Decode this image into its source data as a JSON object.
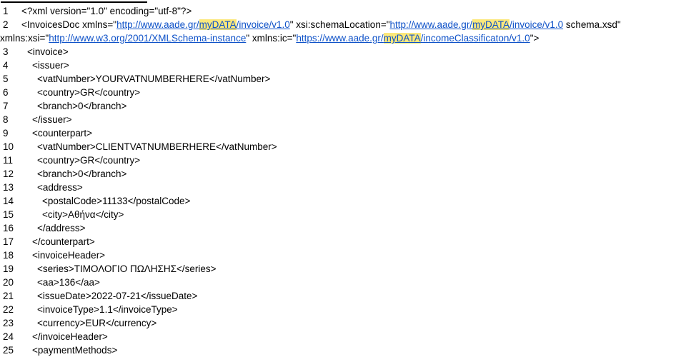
{
  "colors": {
    "text": "#000000",
    "link": "#0f52c8",
    "highlight": "#fbe87b",
    "rule": "#000000",
    "background": "#ffffff"
  },
  "document": {
    "rows": [
      {
        "num": "1",
        "indent": 1,
        "segments": [
          {
            "k": "plain",
            "t": "<?xml version=\"1.0\" encoding=\"utf-8\"?>"
          }
        ]
      },
      {
        "num": "2",
        "indent": 1,
        "segments": [
          {
            "k": "plain",
            "t": "<InvoicesDoc xmlns=\""
          },
          {
            "k": "link",
            "t": "http://www.aade.gr/"
          },
          {
            "k": "hl-link",
            "t": "myDATA"
          },
          {
            "k": "link",
            "t": "/invoice/v1.0"
          },
          {
            "k": "plain",
            "t": "\" xsi:schemaLocation=\""
          },
          {
            "k": "link",
            "t": "http://www.aade.gr/"
          },
          {
            "k": "hl-link",
            "t": "myDATA"
          },
          {
            "k": "link",
            "t": "/invoice/v1.0"
          },
          {
            "k": "plain",
            "t": " schema.xsd\""
          }
        ]
      },
      {
        "num": "",
        "indent": 0,
        "segments": [
          {
            "k": "plain",
            "t": "xmlns:xsi=\""
          },
          {
            "k": "link",
            "t": "http://www.w3.org/2001/XMLSchema-instance"
          },
          {
            "k": "plain",
            "t": "\" xmlns:ic=\""
          },
          {
            "k": "link",
            "t": "https://www.aade.gr/"
          },
          {
            "k": "hl-link",
            "t": "myDATA"
          },
          {
            "k": "link",
            "t": "/incomeClassificaton/v1.0"
          },
          {
            "k": "plain",
            "t": "\">"
          }
        ]
      },
      {
        "num": "3",
        "indent": 2,
        "segments": [
          {
            "k": "plain",
            "t": "<invoice>"
          }
        ]
      },
      {
        "num": "4",
        "indent": 3,
        "segments": [
          {
            "k": "plain",
            "t": "<issuer>"
          }
        ]
      },
      {
        "num": "5",
        "indent": 4,
        "segments": [
          {
            "k": "plain",
            "t": "<vatNumber>YOURVATNUMBERHERE</vatNumber>"
          }
        ]
      },
      {
        "num": "6",
        "indent": 4,
        "segments": [
          {
            "k": "plain",
            "t": "<country>GR</country>"
          }
        ]
      },
      {
        "num": "7",
        "indent": 4,
        "segments": [
          {
            "k": "plain",
            "t": "<branch>0</branch>"
          }
        ]
      },
      {
        "num": "8",
        "indent": 3,
        "segments": [
          {
            "k": "plain",
            "t": "</issuer>"
          }
        ]
      },
      {
        "num": "9",
        "indent": 3,
        "segments": [
          {
            "k": "plain",
            "t": "<counterpart>"
          }
        ]
      },
      {
        "num": "10",
        "indent": 4,
        "segments": [
          {
            "k": "plain",
            "t": "<vatNumber>CLIENTVATNUMBERHERE</vatNumber>"
          }
        ]
      },
      {
        "num": "11",
        "indent": 4,
        "segments": [
          {
            "k": "plain",
            "t": "<country>GR</country>"
          }
        ]
      },
      {
        "num": "12",
        "indent": 4,
        "segments": [
          {
            "k": "plain",
            "t": "<branch>0</branch>"
          }
        ]
      },
      {
        "num": "13",
        "indent": 4,
        "segments": [
          {
            "k": "plain",
            "t": "<address>"
          }
        ]
      },
      {
        "num": "14",
        "indent": 5,
        "segments": [
          {
            "k": "plain",
            "t": "<postalCode>11133</postalCode>"
          }
        ]
      },
      {
        "num": "15",
        "indent": 5,
        "segments": [
          {
            "k": "plain",
            "t": "<city>Αθήνα</city>"
          }
        ]
      },
      {
        "num": "16",
        "indent": 4,
        "segments": [
          {
            "k": "plain",
            "t": "</address>"
          }
        ]
      },
      {
        "num": "17",
        "indent": 3,
        "segments": [
          {
            "k": "plain",
            "t": "</counterpart>"
          }
        ]
      },
      {
        "num": "18",
        "indent": 3,
        "segments": [
          {
            "k": "plain",
            "t": "<invoiceHeader>"
          }
        ]
      },
      {
        "num": "19",
        "indent": 4,
        "segments": [
          {
            "k": "plain",
            "t": "<series>ΤΙΜΟΛΟΓΙΟ ΠΩΛΗΣΗΣ</series>"
          }
        ]
      },
      {
        "num": "20",
        "indent": 4,
        "segments": [
          {
            "k": "plain",
            "t": "<aa>136</aa>"
          }
        ]
      },
      {
        "num": "21",
        "indent": 4,
        "segments": [
          {
            "k": "plain",
            "t": "<issueDate>2022-07-21</issueDate>"
          }
        ]
      },
      {
        "num": "22",
        "indent": 4,
        "segments": [
          {
            "k": "plain",
            "t": "<invoiceType>1.1</invoiceType>"
          }
        ]
      },
      {
        "num": "23",
        "indent": 4,
        "segments": [
          {
            "k": "plain",
            "t": "<currency>EUR</currency>"
          }
        ]
      },
      {
        "num": "24",
        "indent": 3,
        "segments": [
          {
            "k": "plain",
            "t": "</invoiceHeader>"
          }
        ]
      },
      {
        "num": "25",
        "indent": 3,
        "segments": [
          {
            "k": "plain",
            "t": "<paymentMethods>"
          }
        ]
      }
    ]
  }
}
